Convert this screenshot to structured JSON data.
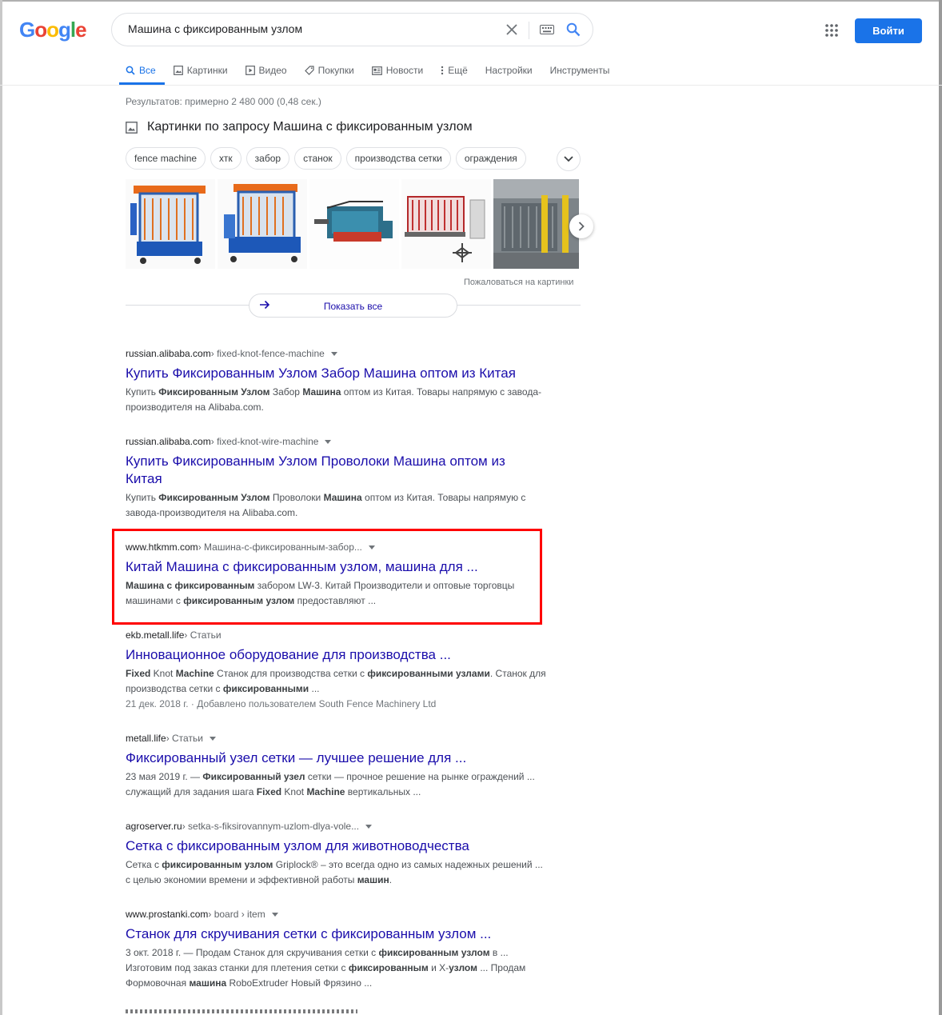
{
  "search": {
    "query": "Машина с фиксированным узлом"
  },
  "header": {
    "signin_label": "Войти",
    "logo_text": "Google"
  },
  "tabs": [
    {
      "label": "Все",
      "icon": "search-icon",
      "active": true
    },
    {
      "label": "Картинки",
      "icon": "image-icon"
    },
    {
      "label": "Видео",
      "icon": "video-icon"
    },
    {
      "label": "Покупки",
      "icon": "tag-icon"
    },
    {
      "label": "Новости",
      "icon": "news-icon"
    },
    {
      "label": "Ещё",
      "icon": "more-vert-icon"
    },
    {
      "label": "Настройки"
    },
    {
      "label": "Инструменты"
    }
  ],
  "stats": "Результатов: примерно 2 480 000 (0,48 сек.)",
  "images": {
    "heading": "Картинки по запросу Машина с фиксированным узлом",
    "chips": [
      "fence machine",
      "хтк",
      "забор",
      "станок",
      "производства сетки",
      "ограждения"
    ],
    "report": "Пожаловаться на картинки",
    "show_all": "Показать все"
  },
  "results": [
    {
      "domain": "russian.alibaba.com",
      "path": " › fixed-knot-fence-machine",
      "menu": true,
      "title": "Купить Фиксированным Узлом Забор Машина оптом из Китая",
      "snippet": "Купить <b>Фиксированным Узлом</b> Забор <b>Машина</b> оптом из Китая. Товары напрямую с завода-производителя на Alibaba.com."
    },
    {
      "domain": "russian.alibaba.com",
      "path": " › fixed-knot-wire-machine",
      "menu": true,
      "title": "Купить Фиксированным Узлом Проволоки Машина оптом из Китая",
      "snippet": "Купить <b>Фиксированным Узлом</b> Проволоки <b>Машина</b> оптом из Китая. Товары напрямую с завода-производителя на Alibaba.com."
    },
    {
      "domain": "www.htkmm.com",
      "path": " › Машина-с-фиксированным-забор...",
      "menu": true,
      "title": "Китай Машина с фиксированным узлом, машина для ...",
      "snippet": "<b>Машина с фиксированным</b> забором LW-3. Китай Производители и оптовые торговцы машинами с <b>фиксированным узлом</b> предоставляют ..."
    },
    {
      "domain": "ekb.metall.life",
      "path": " › Статьи",
      "menu": false,
      "title": "Инновационное оборудование для производства ...",
      "snippet": "<b>Fixed</b> Knot <b>Machine</b> Станок для производства сетки с <b>фиксированными узлами</b>. Станок для производства сетки с <b>фиксированными</b> ...",
      "date": "21 дек. 2018 г. · Добавлено пользователем South Fence Machinery Ltd"
    },
    {
      "domain": "metall.life",
      "path": " › Статьи",
      "menu": true,
      "title": "Фиксированный узел сетки — лучшее решение для ...",
      "snippet": "23 мая 2019 г. — <b>Фиксированный узел</b> сетки — прочное решение на рынке ограждений ... служащий для задания шага <b>Fixed</b> Knot <b>Machine</b> вертикальных ..."
    },
    {
      "domain": "agroserver.ru",
      "path": " › setka-s-fiksirovannym-uzlom-dlya-vole...",
      "menu": true,
      "title": "Сетка с фиксированным узлом для животноводчества",
      "snippet": "Сетка с <b>фиксированным узлом</b> Griplock® – это всегда одно из самых надежных решений ... с целью экономии времени и эффективной работы <b>машин</b>."
    },
    {
      "domain": "www.prostanki.com",
      "path": " › board › item",
      "menu": true,
      "title": "Станок для скручивания сетки с фиксированным узлом ...",
      "snippet": "3 окт. 2018 г. — Продам Станок для скручивания сетки с <b>фиксированным узлом</b> в ... Изготовим под заказ станки для плетения сетки с <b>фиксированным</b> и Х-<b>узлом</b> ... Продам Формовочная <b>машина</b> RoboExtruder Новый Фрязино ..."
    }
  ],
  "colors": {
    "accent": "#1a73e8",
    "link": "#1a0dab",
    "highlight": "#ff0000"
  }
}
